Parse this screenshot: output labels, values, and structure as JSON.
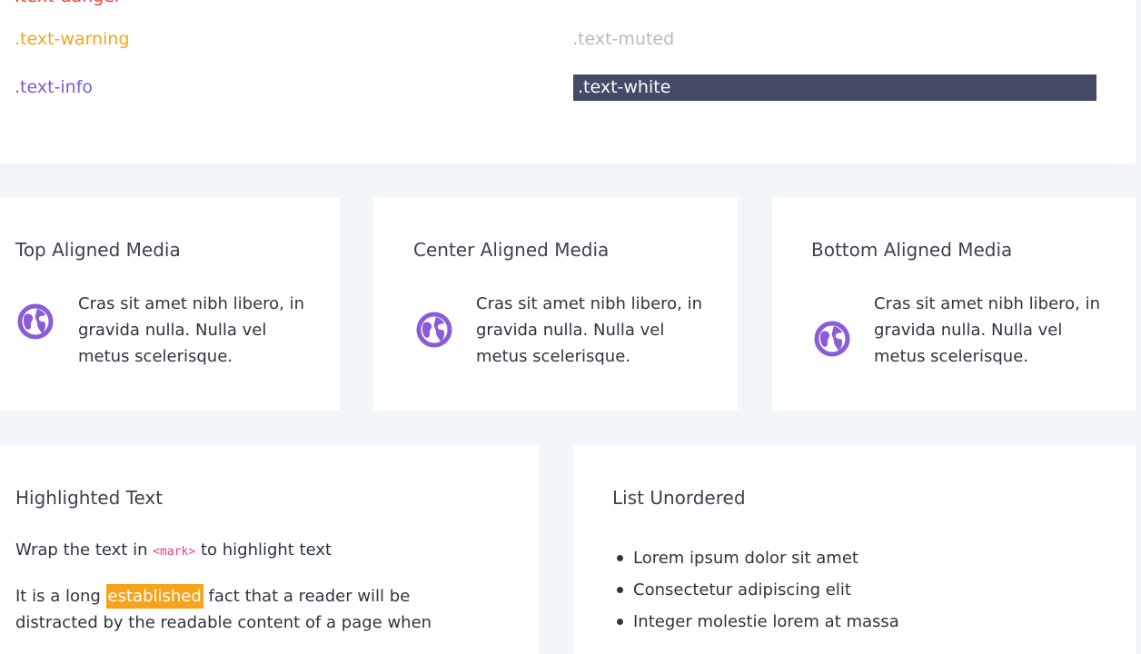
{
  "text_colors": {
    "danger": ".text-danger",
    "warning": ".text-warning",
    "info": ".text-info",
    "muted": ".text-muted",
    "white": ".text-white",
    "colors": {
      "danger": "#ff3b3b",
      "warning": "#f7a41c",
      "info": "#7b5bd6",
      "muted": "#b7b9bd",
      "white_bg": "#434b67"
    }
  },
  "media_cards": [
    {
      "title": "Top Aligned Media",
      "icon": "globe-icon",
      "body": "Cras sit amet nibh libero, in gravida nulla. Nulla vel metus scelerisque."
    },
    {
      "title": "Center Aligned Media",
      "icon": "globe-icon",
      "body": "Cras sit amet nibh libero, in gravida nulla. Nulla vel metus scelerisque."
    },
    {
      "title": "Bottom Aligned Media",
      "icon": "globe-icon",
      "body": "Cras sit amet nibh libero, in gravida nulla. Nulla vel metus scelerisque."
    }
  ],
  "highlight": {
    "title": "Highlighted Text",
    "intro_before": "Wrap the text in",
    "intro_code": "<mark>",
    "intro_after": "to highlight text",
    "para_before": "It is a long",
    "para_mark": "established",
    "para_after": "fact that a reader will be distracted by the readable content of a page when"
  },
  "list": {
    "title": "List Unordered",
    "items": [
      "Lorem ipsum dolor sit amet",
      "Consectetur adipiscing elit",
      "Integer molestie lorem at massa"
    ]
  },
  "accent_color": "#7b5bd6"
}
